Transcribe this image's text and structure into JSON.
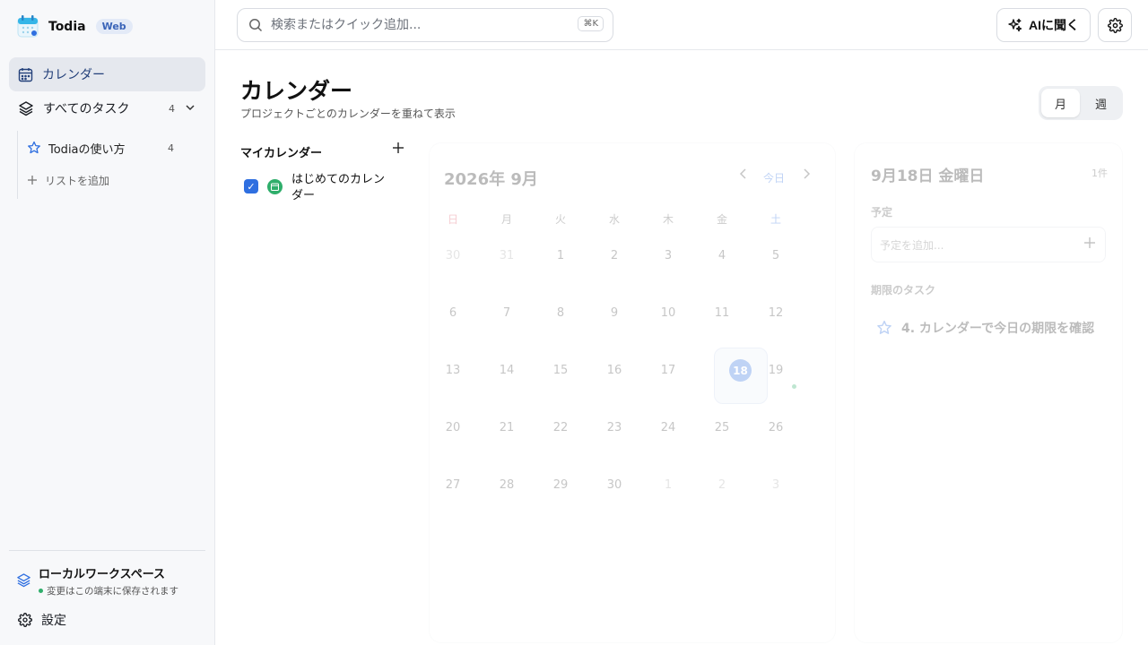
{
  "brand": {
    "name": "Todia",
    "badge": "Web"
  },
  "sidebar": {
    "calendar": {
      "label": "カレンダー"
    },
    "all_tasks": {
      "label": "すべてのタスク",
      "count": "4"
    },
    "lists": [
      {
        "label": "Todiaの使い方",
        "count": "4"
      }
    ],
    "add_list": "リストを追加",
    "workspace": {
      "title": "ローカルワークスペース",
      "subtitle": "変更はこの端末に保存されます"
    },
    "settings": "設定"
  },
  "topbar": {
    "search_placeholder": "検索またはクイック追加...",
    "shortcut": "⌘K",
    "ai_label": "AIに聞く"
  },
  "page": {
    "title": "カレンダー",
    "subtitle": "プロジェクトごとのカレンダーを重ねて表示"
  },
  "view_toggle": {
    "month": "月",
    "week": "週"
  },
  "my_calendars": {
    "title": "マイカレンダー",
    "items": [
      {
        "name": "はじめてのカレンダー",
        "checked": true
      }
    ]
  },
  "calendar": {
    "month_label": "2026年 9月",
    "today": "今日",
    "weekdays": [
      "日",
      "月",
      "火",
      "水",
      "木",
      "金",
      "土"
    ],
    "weeks": [
      [
        "30",
        "31",
        "1",
        "2",
        "3",
        "4",
        "5"
      ],
      [
        "6",
        "7",
        "8",
        "9",
        "10",
        "11",
        "12"
      ],
      [
        "13",
        "14",
        "15",
        "16",
        "17",
        "18",
        "19"
      ],
      [
        "20",
        "21",
        "22",
        "23",
        "24",
        "25",
        "26"
      ],
      [
        "27",
        "28",
        "29",
        "30",
        "1",
        "2",
        "3"
      ]
    ],
    "selected": "18"
  },
  "detail": {
    "date": "9月18日 金曜日",
    "count": "1件",
    "events_label": "予定",
    "add_event_placeholder": "予定を追加...",
    "tasks_label": "期限のタスク",
    "tasks": [
      "4. カレンダーで今日の期限を確認"
    ]
  },
  "colors": {
    "accent": "#2f6fe0",
    "calendar_green": "#2fae6b",
    "sunday": "#e05a6a",
    "saturday": "#2f6fe0"
  }
}
